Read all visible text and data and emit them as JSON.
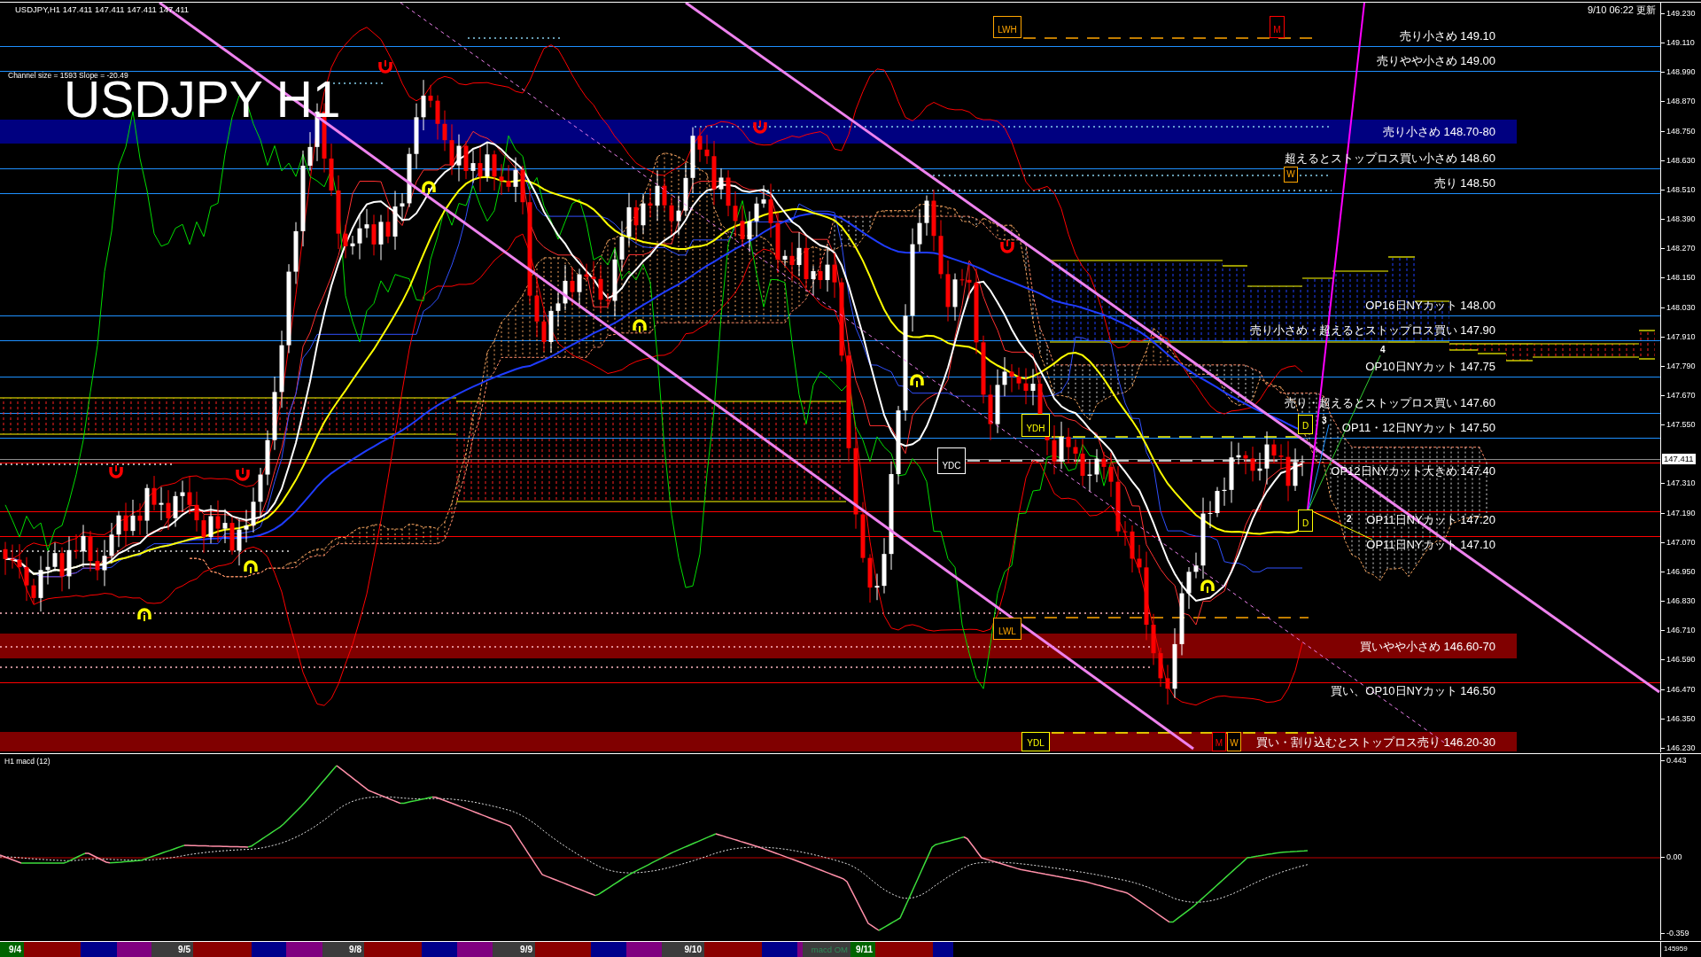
{
  "header": {
    "symbol_line": "USDJPY,H1 147.411 147.411 147.411 147.411",
    "channel_info": "Channel size = 1593 Slope = -20.49",
    "title": "USDJPY H1",
    "updated": "9/10 06:22 更新"
  },
  "levels": [
    {
      "label": "売り小さめ 149.10",
      "kind": "resistance",
      "color": "#1e90ff"
    },
    {
      "label": "売りやや小さめ 149.00",
      "kind": "resistance",
      "color": "#1e90ff"
    },
    {
      "label": "売り小さめ 148.70-80",
      "kind": "band",
      "color": "#000080"
    },
    {
      "label": "超えるとストップロス買い小さめ 148.60",
      "kind": "resistance",
      "color": "#1e90ff"
    },
    {
      "label": "売り 148.50",
      "kind": "resistance",
      "color": "#1e90ff"
    },
    {
      "label": "OP16日NYカット 148.00",
      "kind": "resistance",
      "color": "#1e90ff"
    },
    {
      "label": "売り小さめ・超えるとストップロス買い 147.90",
      "kind": "resistance",
      "color": "#1e90ff"
    },
    {
      "label": "OP10日NYカット 147.75",
      "kind": "resistance",
      "color": "#1e90ff"
    },
    {
      "label": "売り・超えるとストップロス買い 147.60",
      "kind": "resistance",
      "color": "#1e90ff"
    },
    {
      "label": "OP11・12日NYカット 147.50",
      "kind": "resistance",
      "color": "#1e90ff"
    },
    {
      "label": "OP12日NYカット大きめ 147.40",
      "kind": "support",
      "color": "#ff0000"
    },
    {
      "label": "OP11日NYカット 147.20",
      "kind": "support",
      "color": "#ff0000"
    },
    {
      "label": "OP11日NYカット 147.10",
      "kind": "support",
      "color": "#ff0000"
    },
    {
      "label": "買いやや小さめ 146.60-70",
      "kind": "band",
      "color": "#800000"
    },
    {
      "label": "買い、OP10日NYカット 146.50",
      "kind": "support",
      "color": "#ff0000"
    },
    {
      "label": "買い・割り込むとストップロス売り 146.20-30",
      "kind": "band",
      "color": "#800000"
    }
  ],
  "markers": [
    {
      "label": "LWH",
      "color": "#ffa500"
    },
    {
      "label": "M",
      "color": "#ff0000"
    },
    {
      "label": "W",
      "color": "#ffa500"
    },
    {
      "label": "YDH",
      "color": "#ffff00"
    },
    {
      "label": "YDC",
      "color": "#ffffff"
    },
    {
      "label": "D",
      "color": "#ffff00"
    },
    {
      "label": "D",
      "color": "#ffff00"
    },
    {
      "label": "LWL",
      "color": "#ffa500"
    },
    {
      "label": "YDL",
      "color": "#ffff00"
    },
    {
      "label": "M",
      "color": "#ff0000"
    },
    {
      "label": "W",
      "color": "#ffa500"
    }
  ],
  "wave_numbers": [
    "4",
    "3",
    "2"
  ],
  "price_axis": {
    "ticks": [
      "149.230",
      "149.110",
      "148.990",
      "148.870",
      "148.750",
      "148.630",
      "148.510",
      "148.390",
      "148.270",
      "148.150",
      "148.030",
      "147.910",
      "147.790",
      "147.670",
      "147.550",
      "147.310",
      "147.190",
      "147.070",
      "146.950",
      "146.830",
      "146.710",
      "146.590",
      "146.470",
      "146.350",
      "146.230"
    ],
    "current": "147.411"
  },
  "macd": {
    "title": "H1 macd (12)",
    "ticks": [
      "0.443",
      "0.00",
      "-0.359"
    ]
  },
  "timeline": {
    "segments": [
      {
        "color": "#006400",
        "label": "9/4"
      },
      {
        "color": "#8b0000"
      },
      {
        "color": "#00008b"
      },
      {
        "color": "#800080"
      },
      {
        "color": "#3c3c3c",
        "label": "9/5"
      },
      {
        "color": "#8b0000"
      },
      {
        "color": "#00008b"
      },
      {
        "color": "#800080"
      },
      {
        "color": "#3c3c3c",
        "label": "9/8"
      },
      {
        "color": "#8b0000"
      },
      {
        "color": "#00008b"
      },
      {
        "color": "#800080"
      },
      {
        "color": "#3c3c3c",
        "label": "9/9"
      },
      {
        "color": "#8b0000"
      },
      {
        "color": "#00008b"
      },
      {
        "color": "#800080"
      },
      {
        "color": "#3c3c3c",
        "label": "9/10"
      },
      {
        "color": "#8b0000"
      },
      {
        "color": "#00008b"
      },
      {
        "color": "#800080"
      },
      {
        "color": "#3c3c3c",
        "note": "macd OM"
      },
      {
        "color": "#006400",
        "label": "9/11"
      },
      {
        "color": "#8b0000"
      },
      {
        "color": "#00008b"
      }
    ],
    "corner": "145959"
  }
}
